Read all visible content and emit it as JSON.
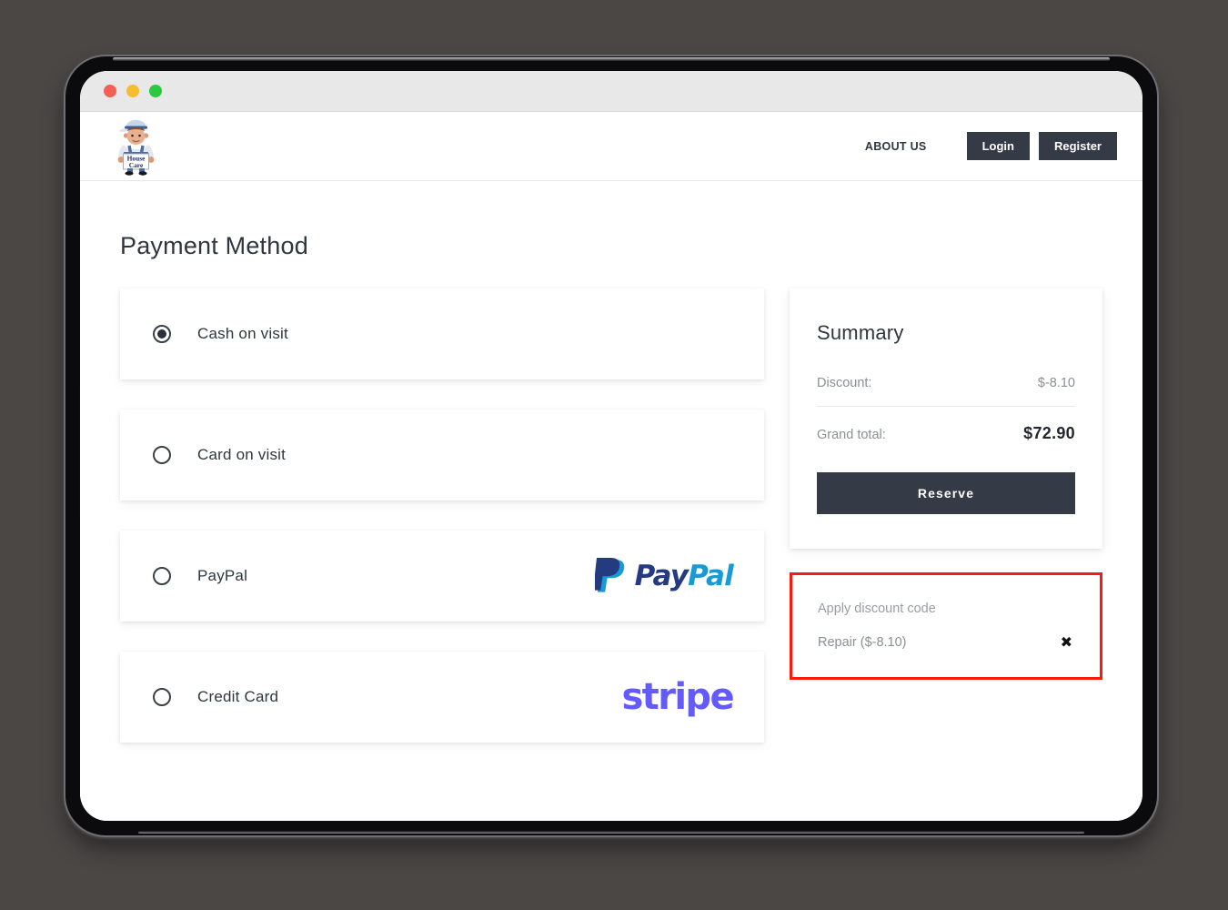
{
  "window": {
    "traffic_lights": [
      "close",
      "minimize",
      "maximize"
    ]
  },
  "header": {
    "logo_alt": "House Care",
    "logo_sign_line1": "House",
    "logo_sign_line2": "Care",
    "nav_about": "ABOUT US",
    "login_label": "Login",
    "register_label": "Register",
    "button_color": "#343a46"
  },
  "main": {
    "page_title": "Payment Method",
    "payment_options": [
      {
        "id": "cash-on-visit",
        "label": "Cash on visit",
        "selected": true,
        "brand": null
      },
      {
        "id": "card-on-visit",
        "label": "Card on visit",
        "selected": false,
        "brand": null
      },
      {
        "id": "paypal",
        "label": "PayPal",
        "selected": false,
        "brand": "paypal"
      },
      {
        "id": "credit-card",
        "label": "Credit Card",
        "selected": false,
        "brand": "stripe"
      }
    ],
    "brands": {
      "paypal": {
        "text_dark": "Pay",
        "text_light": "Pal",
        "color_dark": "#253B80",
        "color_light": "#179BD7"
      },
      "stripe": {
        "text": "stripe",
        "color": "#635BFF"
      }
    }
  },
  "summary": {
    "title": "Summary",
    "discount_label": "Discount:",
    "discount_value": "$-8.10",
    "grand_total_label": "Grand total:",
    "grand_total_value": "$72.90",
    "reserve_label": "Reserve"
  },
  "discount": {
    "apply_label": "Apply discount code",
    "applied_code": "Repair ($-8.10)",
    "remove_icon": "✖",
    "highlight_color": "#f81a0e"
  }
}
